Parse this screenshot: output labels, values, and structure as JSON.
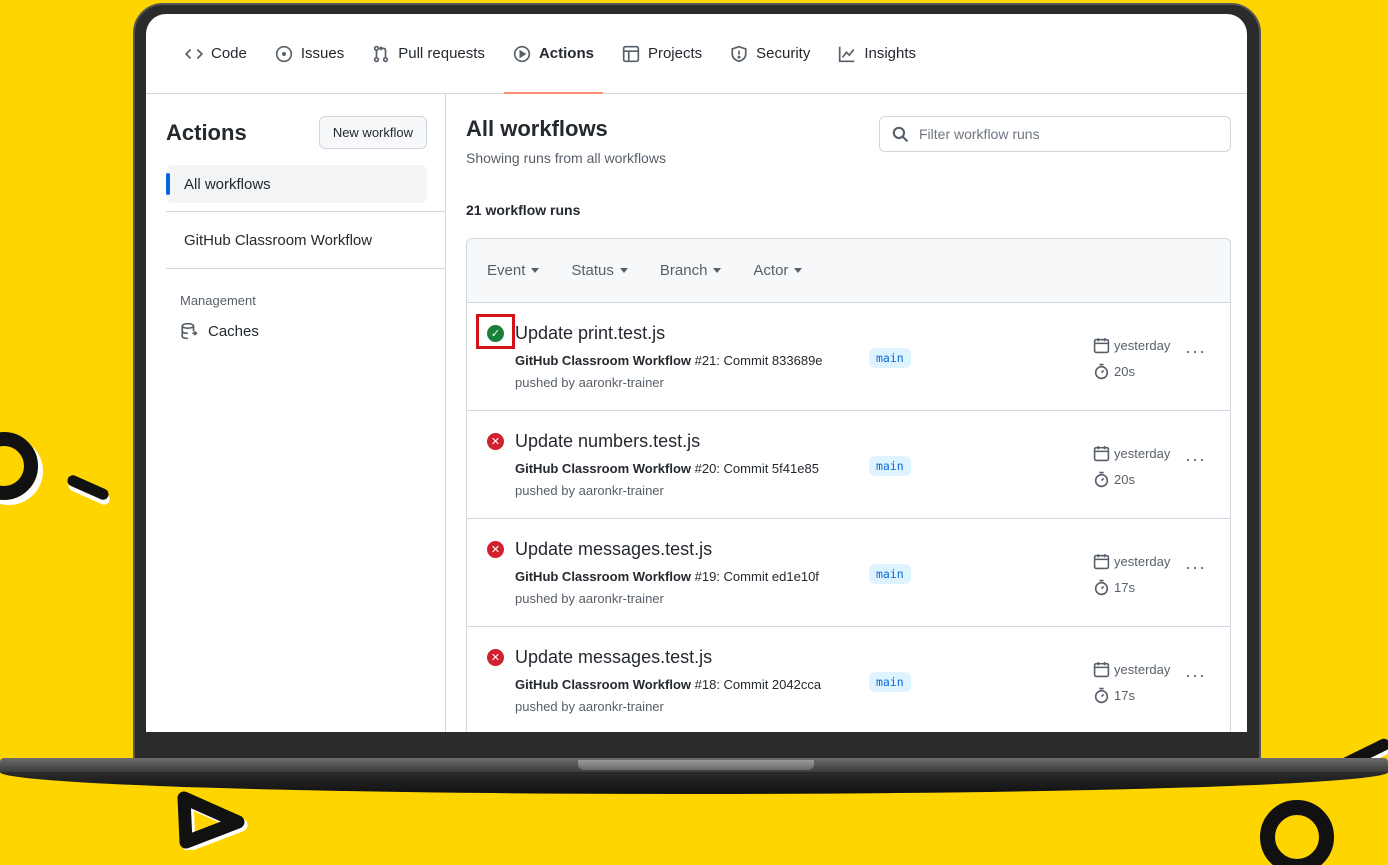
{
  "tabs": [
    {
      "label": "Code",
      "icon": "code-icon"
    },
    {
      "label": "Issues",
      "icon": "issue-icon"
    },
    {
      "label": "Pull requests",
      "icon": "pull-request-icon"
    },
    {
      "label": "Actions",
      "icon": "play-icon",
      "selected": true
    },
    {
      "label": "Projects",
      "icon": "table-icon"
    },
    {
      "label": "Security",
      "icon": "shield-icon"
    },
    {
      "label": "Insights",
      "icon": "graph-icon"
    }
  ],
  "sidebar": {
    "title": "Actions",
    "new_workflow": "New workflow",
    "all_workflows": "All workflows",
    "workflow": "GitHub Classroom Workflow",
    "management": "Management",
    "caches": "Caches"
  },
  "main": {
    "title": "All workflows",
    "subtitle": "Showing runs from all workflows",
    "search_placeholder": "Filter workflow runs",
    "count": "21 workflow runs",
    "filters": [
      "Event",
      "Status",
      "Branch",
      "Actor"
    ]
  },
  "runs": [
    {
      "title": "Update print.test.js",
      "workflow": "GitHub Classroom Workflow",
      "detail": "#21: Commit 833689e",
      "pushed_by": "pushed by aaronkr-trainer",
      "branch": "main",
      "when": "yesterday",
      "duration": "20s",
      "status": "success"
    },
    {
      "title": "Update numbers.test.js",
      "workflow": "GitHub Classroom Workflow",
      "detail": "#20: Commit 5f41e85",
      "pushed_by": "pushed by aaronkr-trainer",
      "branch": "main",
      "when": "yesterday",
      "duration": "20s",
      "status": "failure"
    },
    {
      "title": "Update messages.test.js",
      "workflow": "GitHub Classroom Workflow",
      "detail": "#19: Commit ed1e10f",
      "pushed_by": "pushed by aaronkr-trainer",
      "branch": "main",
      "when": "yesterday",
      "duration": "17s",
      "status": "failure"
    },
    {
      "title": "Update messages.test.js",
      "workflow": "GitHub Classroom Workflow",
      "detail": "#18: Commit 2042cca",
      "pushed_by": "pushed by aaronkr-trainer",
      "branch": "main",
      "when": "yesterday",
      "duration": "17s",
      "status": "failure"
    }
  ],
  "colors": {
    "background": "#FFD500",
    "success": "#1a7f37",
    "failure": "#cf222e",
    "accent": "#fd8c73",
    "highlight": "#d3121a"
  }
}
